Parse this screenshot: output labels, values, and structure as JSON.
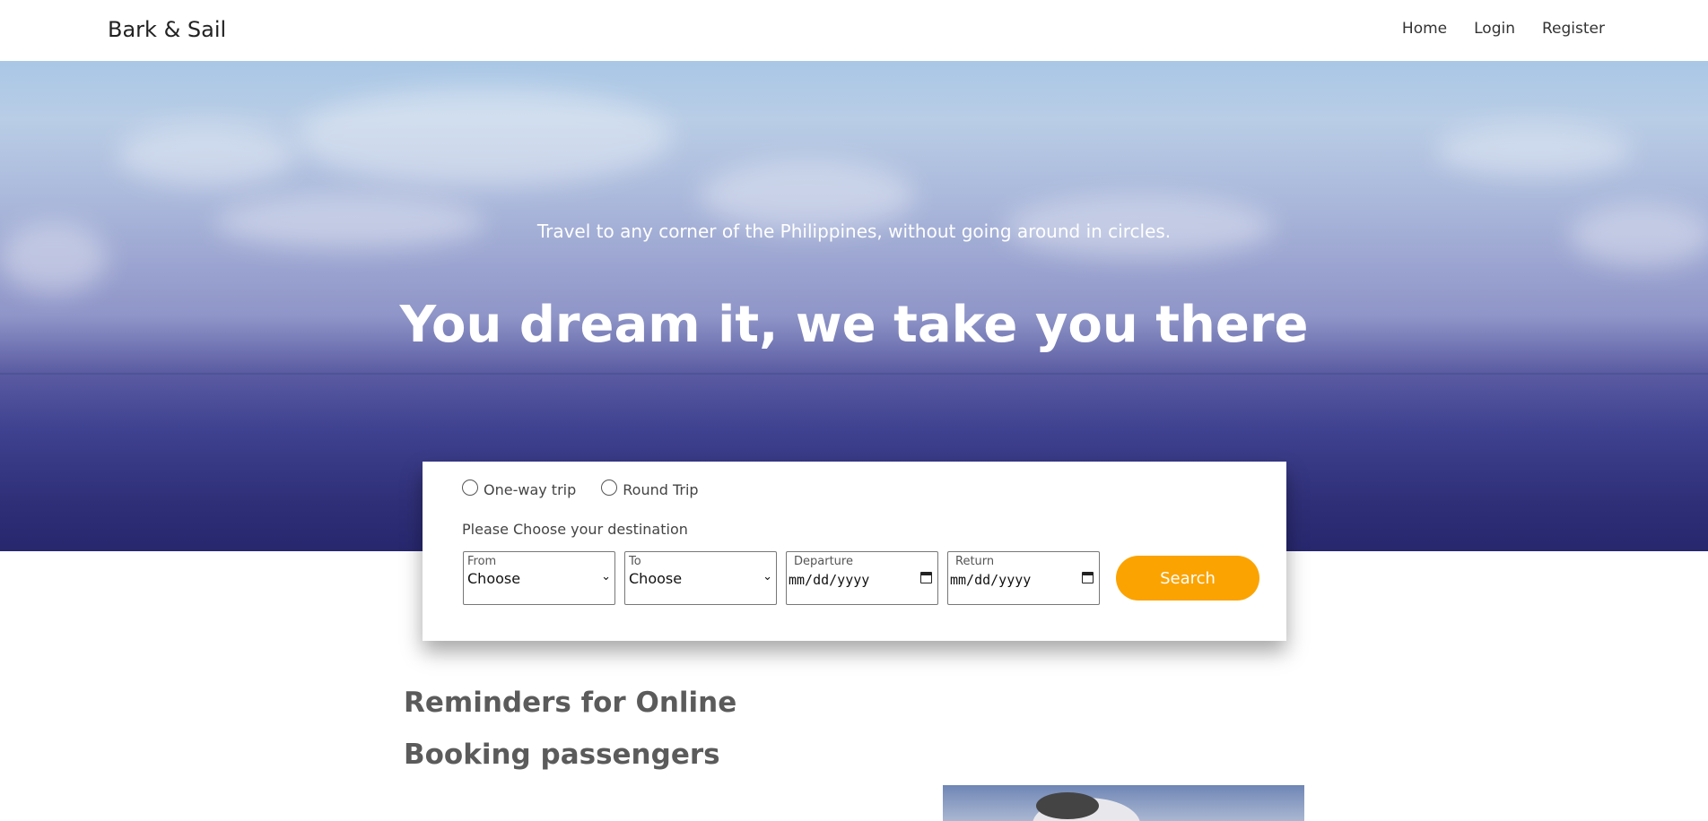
{
  "nav": {
    "brand": "Bark & Sail",
    "links": [
      "Home",
      "Login",
      "Register"
    ]
  },
  "hero": {
    "tagline": "Travel to any corner of the Philippines, without going around in circles.",
    "title": "You dream it, we take you there"
  },
  "search": {
    "trip_types": [
      "One-way trip",
      "Round Trip"
    ],
    "destination_label": "Please Choose your destination",
    "from": {
      "label": "From",
      "value": "Choose"
    },
    "to": {
      "label": "To",
      "value": "Choose"
    },
    "departure": {
      "label": "Departure",
      "value": "mm/dd/yyyy"
    },
    "return": {
      "label": "Return",
      "value": "mm/dd/yyyy"
    },
    "button": "Search",
    "button_color": "#fba300"
  },
  "content": {
    "heading_line1": "Reminders for Online",
    "heading_line2": "Booking passengers"
  }
}
